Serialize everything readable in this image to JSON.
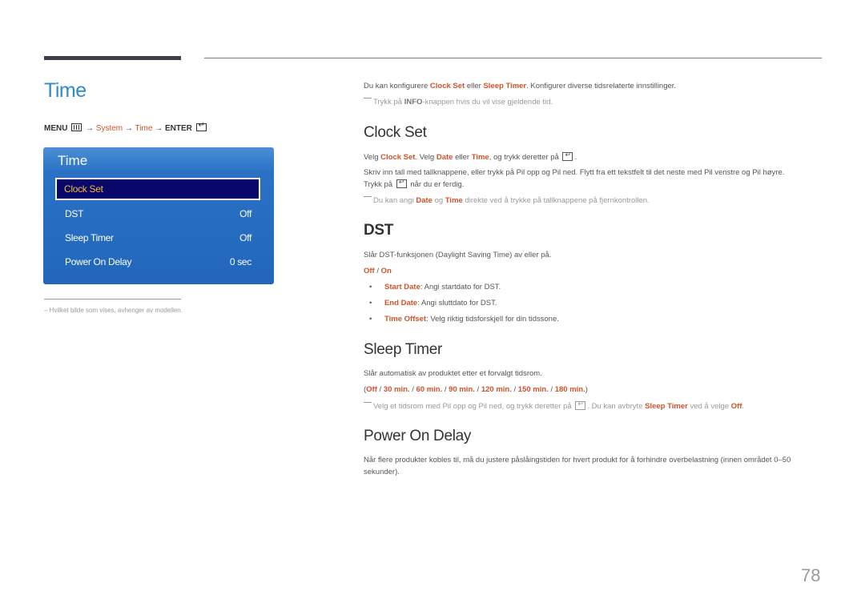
{
  "page_title": "Time",
  "menu_path": {
    "menu": "MENU",
    "arrow": "→",
    "system": "System",
    "time": "Time",
    "enter": "ENTER"
  },
  "osd": {
    "title": "Time",
    "items": [
      {
        "label": "Clock Set",
        "value": "",
        "selected": true
      },
      {
        "label": "DST",
        "value": "Off"
      },
      {
        "label": "Sleep Timer",
        "value": "Off"
      },
      {
        "label": "Power On Delay",
        "value": "0 sec"
      }
    ]
  },
  "footnote": "– Hvilket bilde som vises, avhenger av modellen.",
  "intro": {
    "t1": "Du kan konfigurere ",
    "h1": "Clock Set",
    "t2": " eller ",
    "h2": "Sleep Timer",
    "t3": ". Konfigurer diverse tidsrelaterte innstillinger."
  },
  "intro_note": {
    "t1": "Trykk på ",
    "b1": "INFO",
    "t2": "-knappen hvis du vil vise gjeldende tid."
  },
  "clock_set": {
    "heading": "Clock Set",
    "p1": {
      "t1": "Velg ",
      "h1": "Clock Set",
      "t2": ". Velg ",
      "h2": "Date",
      "t3": " eller ",
      "h3": "Time",
      "t4": ", og trykk deretter på ",
      "t5": "."
    },
    "p2": "Skriv inn tall med tallknappene, eller trykk på Pil opp og Pil ned. Flytt fra ett tekstfelt til det neste med Pil venstre og Pil høyre.",
    "p3": {
      "t1": "Trykk på ",
      "t2": " når du er ferdig."
    },
    "note": {
      "t1": "Du kan angi ",
      "h1": "Date",
      "t2": " og ",
      "h2": "Time",
      "t3": " direkte ved å trykke på tallknappene på fjernkontrollen."
    }
  },
  "dst": {
    "heading": "DST",
    "p1": "Slår DST-funksjonen (Daylight Saving Time) av eller på.",
    "options": {
      "off": "Off",
      "sep": " / ",
      "on": "On"
    },
    "bullets": [
      {
        "term": "Start Date",
        "text": ": Angi startdato for DST."
      },
      {
        "term": "End Date",
        "text": ": Angi sluttdato for DST."
      },
      {
        "term": "Time Offset",
        "text": ": Velg riktig tidsforskjell for din tidssone."
      }
    ]
  },
  "sleep_timer": {
    "heading": "Sleep Timer",
    "p1": "Slår automatisk av produktet etter et forvalgt tidsrom.",
    "options": [
      "Off",
      "30 min.",
      "60 min.",
      "90 min.",
      "120 min.",
      "150 min.",
      "180 min."
    ],
    "note": {
      "t1": "Velg et tidsrom med Pil opp og Pil ned, og trykk deretter på ",
      "t2": ". Du kan avbryte ",
      "h1": "Sleep Timer",
      "t3": " ved å velge ",
      "h2": "Off",
      "t4": "."
    }
  },
  "power_on_delay": {
    "heading": "Power On Delay",
    "p1": "Når flere produkter kobles til, må du justere påslåingstiden for hvert produkt for å forhindre overbelastning (innen området 0–50",
    "p2": "sekunder)."
  },
  "page_number": "78"
}
